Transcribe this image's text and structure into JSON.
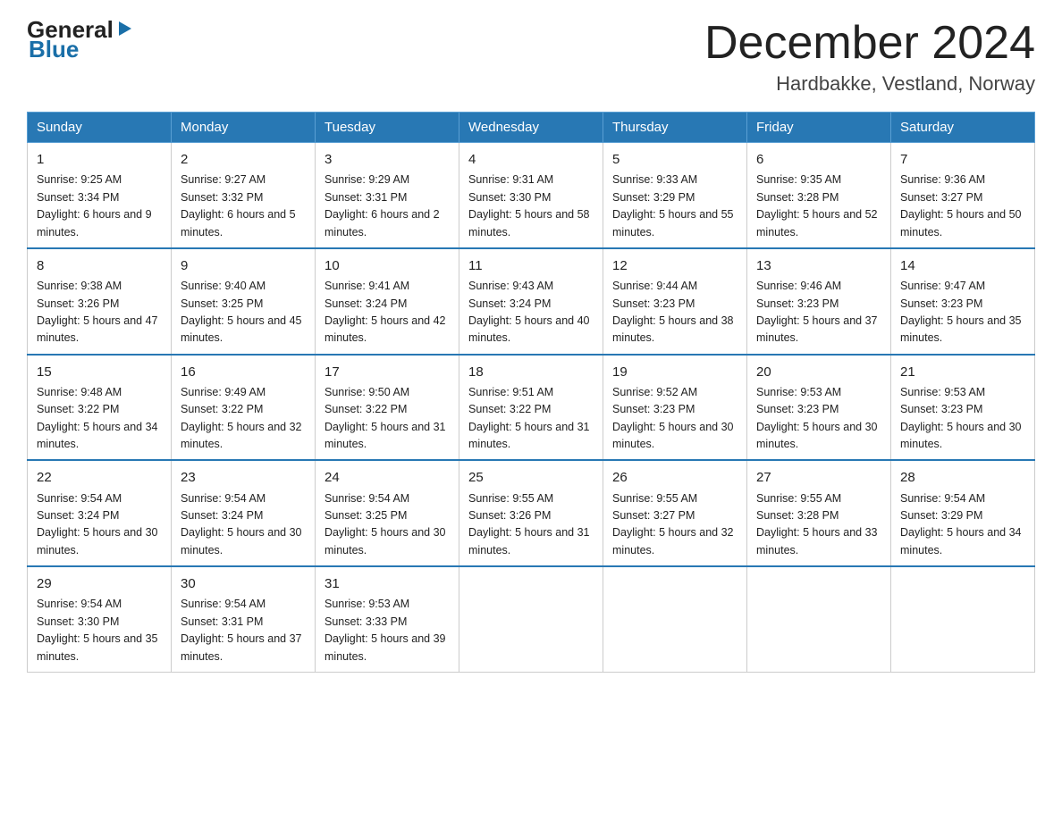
{
  "header": {
    "logo_general": "General",
    "logo_blue": "Blue",
    "month_title": "December 2024",
    "location": "Hardbakke, Vestland, Norway"
  },
  "days_of_week": [
    "Sunday",
    "Monday",
    "Tuesday",
    "Wednesday",
    "Thursday",
    "Friday",
    "Saturday"
  ],
  "weeks": [
    [
      {
        "day": "1",
        "sunrise": "9:25 AM",
        "sunset": "3:34 PM",
        "daylight": "6 hours and 9 minutes."
      },
      {
        "day": "2",
        "sunrise": "9:27 AM",
        "sunset": "3:32 PM",
        "daylight": "6 hours and 5 minutes."
      },
      {
        "day": "3",
        "sunrise": "9:29 AM",
        "sunset": "3:31 PM",
        "daylight": "6 hours and 2 minutes."
      },
      {
        "day": "4",
        "sunrise": "9:31 AM",
        "sunset": "3:30 PM",
        "daylight": "5 hours and 58 minutes."
      },
      {
        "day": "5",
        "sunrise": "9:33 AM",
        "sunset": "3:29 PM",
        "daylight": "5 hours and 55 minutes."
      },
      {
        "day": "6",
        "sunrise": "9:35 AM",
        "sunset": "3:28 PM",
        "daylight": "5 hours and 52 minutes."
      },
      {
        "day": "7",
        "sunrise": "9:36 AM",
        "sunset": "3:27 PM",
        "daylight": "5 hours and 50 minutes."
      }
    ],
    [
      {
        "day": "8",
        "sunrise": "9:38 AM",
        "sunset": "3:26 PM",
        "daylight": "5 hours and 47 minutes."
      },
      {
        "day": "9",
        "sunrise": "9:40 AM",
        "sunset": "3:25 PM",
        "daylight": "5 hours and 45 minutes."
      },
      {
        "day": "10",
        "sunrise": "9:41 AM",
        "sunset": "3:24 PM",
        "daylight": "5 hours and 42 minutes."
      },
      {
        "day": "11",
        "sunrise": "9:43 AM",
        "sunset": "3:24 PM",
        "daylight": "5 hours and 40 minutes."
      },
      {
        "day": "12",
        "sunrise": "9:44 AM",
        "sunset": "3:23 PM",
        "daylight": "5 hours and 38 minutes."
      },
      {
        "day": "13",
        "sunrise": "9:46 AM",
        "sunset": "3:23 PM",
        "daylight": "5 hours and 37 minutes."
      },
      {
        "day": "14",
        "sunrise": "9:47 AM",
        "sunset": "3:23 PM",
        "daylight": "5 hours and 35 minutes."
      }
    ],
    [
      {
        "day": "15",
        "sunrise": "9:48 AM",
        "sunset": "3:22 PM",
        "daylight": "5 hours and 34 minutes."
      },
      {
        "day": "16",
        "sunrise": "9:49 AM",
        "sunset": "3:22 PM",
        "daylight": "5 hours and 32 minutes."
      },
      {
        "day": "17",
        "sunrise": "9:50 AM",
        "sunset": "3:22 PM",
        "daylight": "5 hours and 31 minutes."
      },
      {
        "day": "18",
        "sunrise": "9:51 AM",
        "sunset": "3:22 PM",
        "daylight": "5 hours and 31 minutes."
      },
      {
        "day": "19",
        "sunrise": "9:52 AM",
        "sunset": "3:23 PM",
        "daylight": "5 hours and 30 minutes."
      },
      {
        "day": "20",
        "sunrise": "9:53 AM",
        "sunset": "3:23 PM",
        "daylight": "5 hours and 30 minutes."
      },
      {
        "day": "21",
        "sunrise": "9:53 AM",
        "sunset": "3:23 PM",
        "daylight": "5 hours and 30 minutes."
      }
    ],
    [
      {
        "day": "22",
        "sunrise": "9:54 AM",
        "sunset": "3:24 PM",
        "daylight": "5 hours and 30 minutes."
      },
      {
        "day": "23",
        "sunrise": "9:54 AM",
        "sunset": "3:24 PM",
        "daylight": "5 hours and 30 minutes."
      },
      {
        "day": "24",
        "sunrise": "9:54 AM",
        "sunset": "3:25 PM",
        "daylight": "5 hours and 30 minutes."
      },
      {
        "day": "25",
        "sunrise": "9:55 AM",
        "sunset": "3:26 PM",
        "daylight": "5 hours and 31 minutes."
      },
      {
        "day": "26",
        "sunrise": "9:55 AM",
        "sunset": "3:27 PM",
        "daylight": "5 hours and 32 minutes."
      },
      {
        "day": "27",
        "sunrise": "9:55 AM",
        "sunset": "3:28 PM",
        "daylight": "5 hours and 33 minutes."
      },
      {
        "day": "28",
        "sunrise": "9:54 AM",
        "sunset": "3:29 PM",
        "daylight": "5 hours and 34 minutes."
      }
    ],
    [
      {
        "day": "29",
        "sunrise": "9:54 AM",
        "sunset": "3:30 PM",
        "daylight": "5 hours and 35 minutes."
      },
      {
        "day": "30",
        "sunrise": "9:54 AM",
        "sunset": "3:31 PM",
        "daylight": "5 hours and 37 minutes."
      },
      {
        "day": "31",
        "sunrise": "9:53 AM",
        "sunset": "3:33 PM",
        "daylight": "5 hours and 39 minutes."
      },
      null,
      null,
      null,
      null
    ]
  ]
}
